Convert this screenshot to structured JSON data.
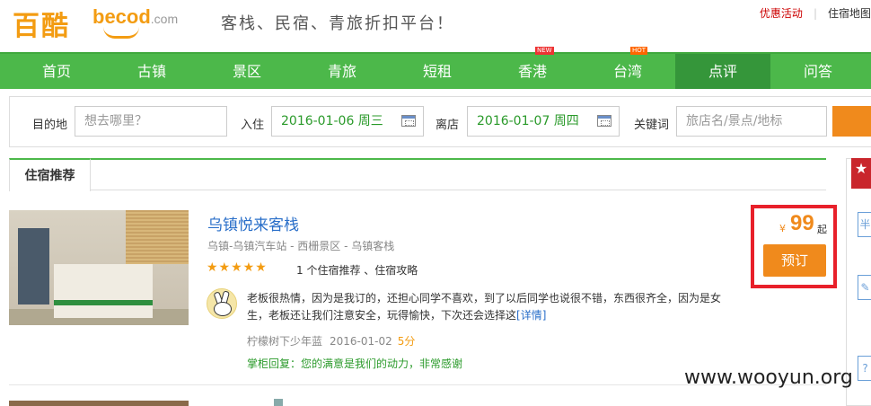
{
  "header": {
    "logo_cn": "百酷",
    "logo_en": "becod",
    "logo_domain": ".com",
    "slogan": "客栈、民宿、青旅折扣平台！",
    "promo_link": "优惠活动",
    "map_link": "住宿地图"
  },
  "nav": {
    "items": [
      {
        "label": "首页"
      },
      {
        "label": "古镇"
      },
      {
        "label": "景区"
      },
      {
        "label": "青旅"
      },
      {
        "label": "短租"
      },
      {
        "label": "香港",
        "badge": "NEW"
      },
      {
        "label": "台湾",
        "badge": "HOT"
      },
      {
        "label": "点评",
        "active": true
      },
      {
        "label": "问答"
      }
    ]
  },
  "search": {
    "destination_label": "目的地",
    "destination_placeholder": "想去哪里？",
    "checkin_label": "入住",
    "checkin_value": "2016-01-06 周三",
    "checkout_label": "离店",
    "checkout_value": "2016-01-07 周四",
    "keyword_label": "关键词",
    "keyword_placeholder": "旅店名/景点/地标"
  },
  "tabs": {
    "active": "住宿推荐"
  },
  "hotel": {
    "name": "乌镇悦来客栈",
    "location": "乌镇-乌镇汽车站 - 西栅景区 - 乌镇客栈",
    "stars": "★★★★★",
    "recommend_text": "1 个住宿推荐 、住宿攻略",
    "price_currency": "¥",
    "price": "99",
    "price_unit": "起",
    "book_label": "预订"
  },
  "review": {
    "text": "老板很热情，因为是我订的，还担心同学不喜欢，到了以后同学也说很不错，东西很齐全，因为是女生，老板还让我们注意安全，玩得愉快，下次还会选择这",
    "more_label": "[详情]",
    "author": "柠檬树下少年蓝",
    "date": "2016-01-02",
    "score": "5分",
    "owner_reply": "掌柜回复：您的满意是我们的动力，非常感谢"
  },
  "sidebar": {
    "ribbon_icon": "★",
    "icons": [
      "bookmark-icon",
      "edit-icon",
      "help-icon"
    ]
  },
  "watermark": "www.wooyun.org"
}
